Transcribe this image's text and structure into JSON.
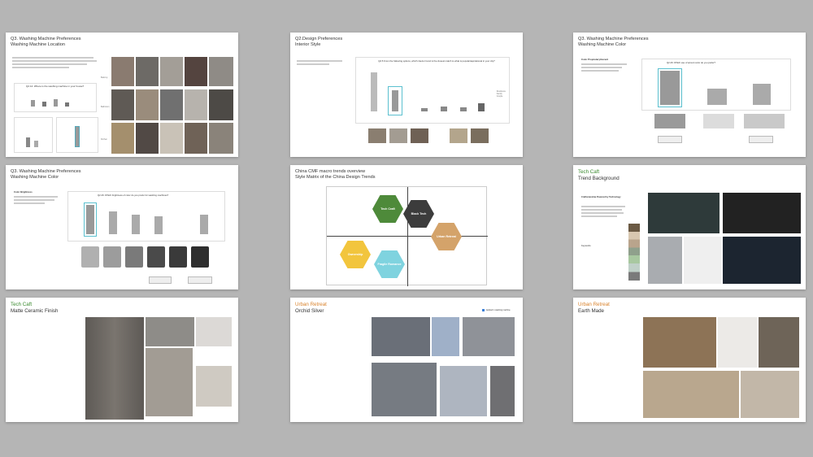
{
  "slides": [
    {
      "title": "Q3. Washing Machine Preferences",
      "subtitle": "Washing Machine Location",
      "q1": "Q2.12: Where is the washing machine in your house?",
      "row_labels": [
        "Balcony",
        "Bathroom",
        "Kitchen"
      ]
    },
    {
      "title": "Q2.Design Preferences",
      "subtitle": "Interior Style",
      "question": "Q2.5 From the following options, which interior trend is the closest match to what is popular/aspirational in your city?",
      "legend": [
        "Residence",
        "Family",
        "Couple"
      ]
    },
    {
      "title": "Q3. Washing Machine Preferences",
      "subtitle": "Washing Machine Color",
      "side_note": "Color Proprietary/Accent",
      "question": "Q2.26: Which use of accent color do you prefer?"
    },
    {
      "title": "Q3. Washing Machine Preferences",
      "subtitle": "Washing Machine Color",
      "side_note": "Color Brightness",
      "question": "Q2.26: Which brightness of color do you prefer for washing machines?"
    },
    {
      "title": "China CMF macro trends overview",
      "subtitle": "Style Matrix of the China Design Trends",
      "hexes": [
        {
          "label": "Tech Craft",
          "color": "#4e8a3a"
        },
        {
          "label": "Black Tech",
          "color": "#3c3c3c"
        },
        {
          "label": "Urban Retreat",
          "color": "#d4a36a"
        },
        {
          "label": "Ownership",
          "color": "#f2c53d"
        },
        {
          "label": "Fragile Romance",
          "color": "#7fd3df"
        }
      ]
    },
    {
      "title": "Tech Caft",
      "subtitle": "Trend Background",
      "side_note": "Craftsmanship Powered by Technology",
      "side_note2": "Keywords:"
    },
    {
      "title": "Tech Caft",
      "subtitle": "Matte Ceramic Finish"
    },
    {
      "title": "Urban Retreat",
      "subtitle": "Orchid Silver",
      "badge": "Applied in washing machine"
    },
    {
      "title": "Urban Retreat",
      "subtitle": "Earth Made"
    }
  ],
  "colors": {
    "background": "#b5b5b5",
    "accent_orange": "#d9822b",
    "accent_green": "#3a8a2e"
  }
}
